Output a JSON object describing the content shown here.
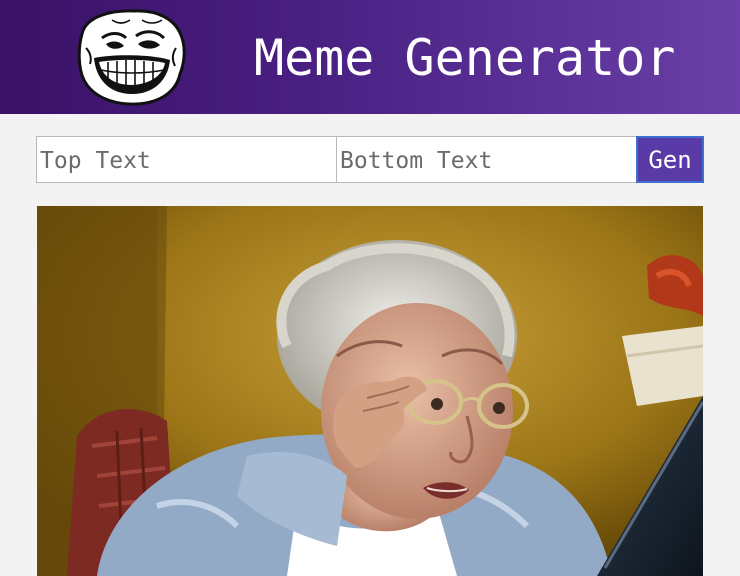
{
  "header": {
    "title": "Meme Generator",
    "logo_icon": "troll-face-icon",
    "colors": {
      "gradient_start": "#3a1166",
      "gradient_end": "#6a40a8"
    }
  },
  "form": {
    "top_text": {
      "value": "",
      "placeholder": "Top Text"
    },
    "bottom_text": {
      "value": "",
      "placeholder": "Bottom Text"
    },
    "generate_label": "Gen",
    "button_color": "#5a3aa6"
  },
  "meme_image": {
    "subject": "photo-elderly-woman-peering-at-laptop"
  }
}
